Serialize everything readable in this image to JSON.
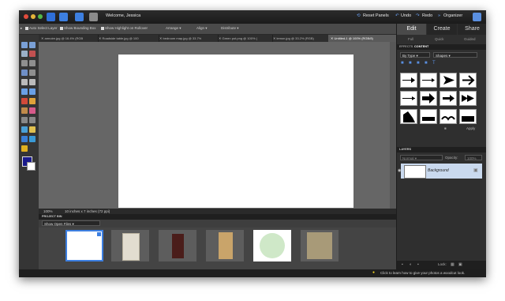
{
  "titlebar": {
    "welcome": "Welcome, Jessica",
    "reset_panels": "Reset Panels",
    "undo": "Undo",
    "redo": "Redo",
    "organizer": "Organizer"
  },
  "options": {
    "auto_select": "Auto Select Layer",
    "show_bbox": "Show Bounding Box",
    "show_highlight": "Show Highlight on Rollover",
    "arrange": "Arrange",
    "align": "Align",
    "distribute": "Distribute"
  },
  "doc_tabs": [
    {
      "label": "armoire.jpg @ 16.4% (RGB",
      "active": false
    },
    {
      "label": "Roadside table.jpg @ 100",
      "active": false
    },
    {
      "label": "bedroom map.jpg @ 33.7%",
      "active": false
    },
    {
      "label": "Green pot.png @ 100% (",
      "active": false
    },
    {
      "label": "lemon.jpg @ 33.2% (RGB)",
      "active": false
    },
    {
      "label": "Untitled-1 @ 100% (RGB/8)",
      "active": true
    }
  ],
  "status": {
    "zoom": "100%",
    "dimensions": "10 inches x 7 inches (72 ppi)"
  },
  "project_bin": {
    "title": "PROJECT BIN",
    "show": "Show Open Files",
    "thumbs": [
      {
        "name": "untitled",
        "color": "#ffffff"
      },
      {
        "name": "armoire",
        "color": "#e2ddd0"
      },
      {
        "name": "table",
        "color": "#4a1d1a"
      },
      {
        "name": "map",
        "color": "#c9a46a"
      },
      {
        "name": "green pot",
        "color": "#cfe8c8"
      },
      {
        "name": "lemon",
        "color": "#a89a78"
      }
    ]
  },
  "panel": {
    "tabs": {
      "edit": "Edit",
      "create": "Create",
      "share": "Share"
    },
    "subtabs": {
      "full": "Full",
      "quick": "Quick",
      "guided": "Guided"
    },
    "effects_tab": "EFFECTS",
    "content_tab": "CONTENT",
    "by_type": "By Type",
    "category": "Shapes",
    "apply": "Apply",
    "layers_title": "LAYERS",
    "blend": "Normal",
    "opacity_label": "Opacity:",
    "opacity": "100%",
    "layer_name": "Background",
    "lock_label": "Lock:"
  },
  "hint": "Click to learn how to give your photos a woodcut look.",
  "colors": {
    "accent": "#2f6fd8",
    "window": "#3a3a3a",
    "canvas": "#666666"
  }
}
